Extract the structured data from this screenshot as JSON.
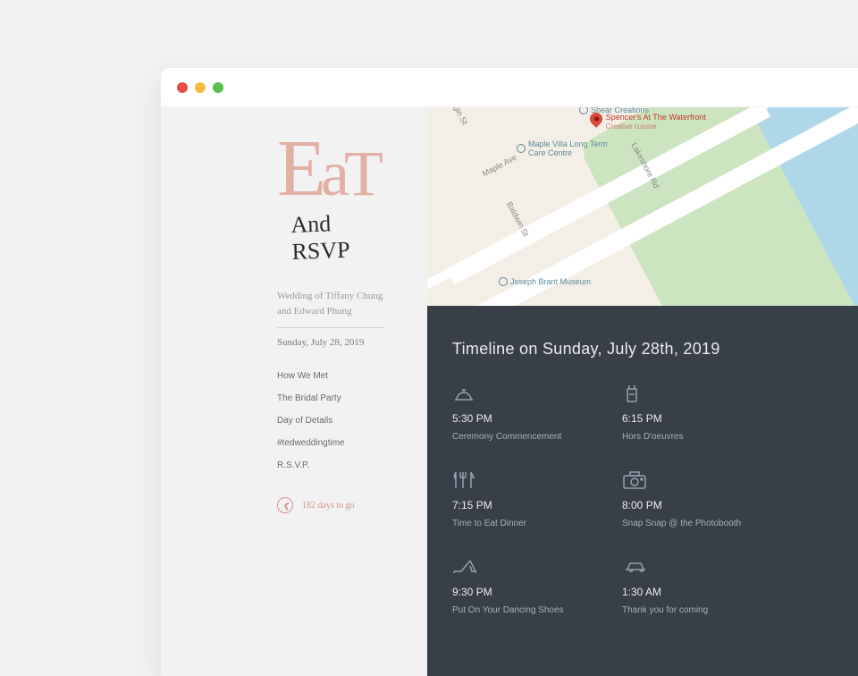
{
  "sidebar": {
    "logo_main": "EaT",
    "logo_script": "And RSVP",
    "wedding_of_line1": "Wedding of Tiffany Chung",
    "wedding_of_line2": "and Edward Phung",
    "date": "Sunday, July 28, 2019",
    "nav": [
      "How We Met",
      "The Bridal Party",
      "Day of Details",
      "#tedweddingtime",
      "R.S.V.P."
    ],
    "countdown": "182 days to go"
  },
  "map": {
    "roads": {
      "lakeshore": "Lakeshore Rd",
      "maple": "Maple Ave",
      "elgin": "Elgin St",
      "baldwin": "Baldwin St"
    },
    "poi": {
      "maplevilla": "Maple Villa Long Term Care Centre",
      "brant": "Joseph Brant Museum",
      "shear": "Shear Creations"
    },
    "venue": {
      "name": "Spencer's At The Waterfront",
      "sub": "Creative cuisine"
    }
  },
  "timeline": {
    "title": "Timeline on Sunday, July 28th, 2019",
    "events": [
      {
        "time": "5:30 PM",
        "label": "Ceremony Commencement",
        "icon": "dome-icon"
      },
      {
        "time": "6:15 PM",
        "label": "Hors D'oeuvres",
        "icon": "drink-icon"
      },
      {
        "time": "7:15 PM",
        "label": "Time to Eat Dinner",
        "icon": "utensils-icon"
      },
      {
        "time": "8:00 PM",
        "label": "Snap Snap @ the Photobooth",
        "icon": "camera-icon"
      },
      {
        "time": "9:30 PM",
        "label": "Put On Your Dancing Shoes",
        "icon": "shoe-icon"
      },
      {
        "time": "1:30 AM",
        "label": "Thank you for coming",
        "icon": "car-icon"
      }
    ]
  }
}
